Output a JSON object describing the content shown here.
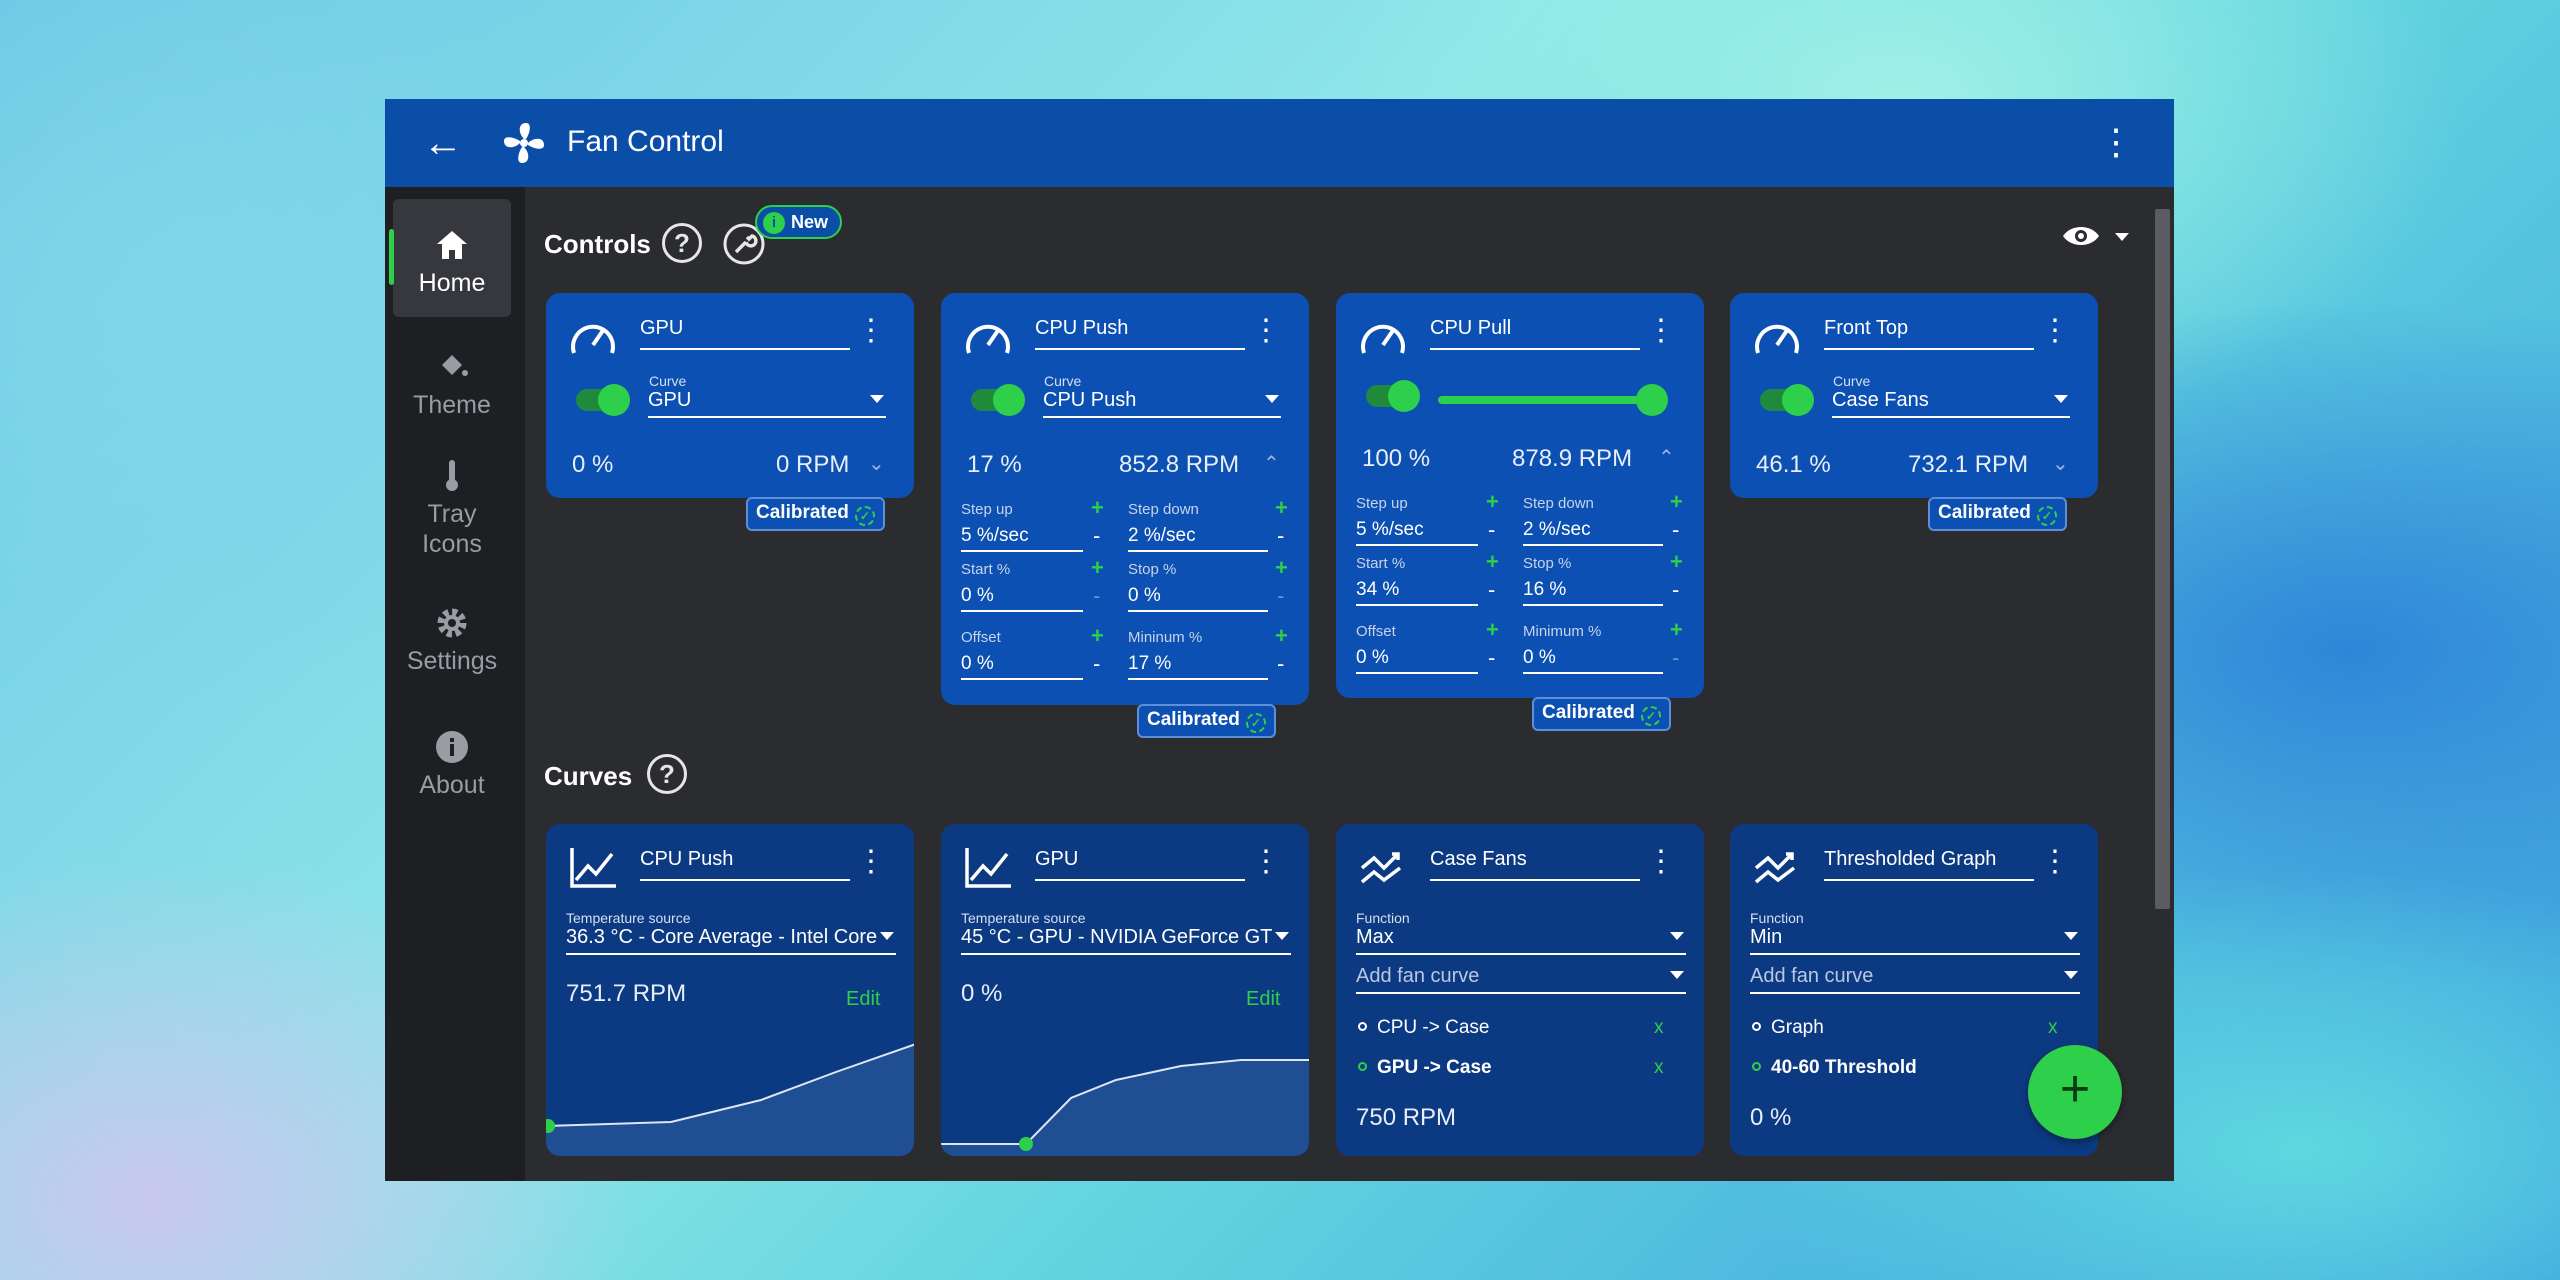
{
  "app": {
    "title": "Fan Control"
  },
  "nav": [
    {
      "label": "Home"
    },
    {
      "label": "Theme"
    },
    {
      "label": "Tray Icons"
    },
    {
      "label": "Settings"
    },
    {
      "label": "About"
    }
  ],
  "controls": {
    "heading": "Controls",
    "new_badge": "New",
    "cards": [
      {
        "name": "GPU",
        "curve_label": "Curve",
        "curve": "GPU",
        "percent": "0 %",
        "rpm": "0 RPM",
        "calibrated": "Calibrated"
      },
      {
        "name": "CPU Push",
        "curve_label": "Curve",
        "curve": "CPU Push",
        "percent": "17 %",
        "rpm": "852.8 RPM",
        "calibrated": "Calibrated",
        "step_up_label": "Step up",
        "step_up": "5 %/sec",
        "step_down_label": "Step down",
        "step_down": "2 %/sec",
        "start_label": "Start %",
        "start": "0 %",
        "stop_label": "Stop %",
        "stop": "0 %",
        "offset_label": "Offset",
        "offset": "0 %",
        "min_label": "Mininum %",
        "min": "17 %"
      },
      {
        "name": "CPU Pull",
        "percent": "100 %",
        "rpm": "878.9 RPM",
        "calibrated": "Calibrated",
        "slider_value": 1.0,
        "step_up_label": "Step up",
        "step_up": "5 %/sec",
        "step_down_label": "Step down",
        "step_down": "2 %/sec",
        "start_label": "Start %",
        "start": "34 %",
        "stop_label": "Stop %",
        "stop": "16 %",
        "offset_label": "Offset",
        "offset": "0 %",
        "min_label": "Minimum %",
        "min": "0 %"
      },
      {
        "name": "Front Top",
        "curve_label": "Curve",
        "curve": "Case Fans",
        "percent": "46.1 %",
        "rpm": "732.1 RPM",
        "calibrated": "Calibrated"
      }
    ]
  },
  "curves": {
    "heading": "Curves",
    "cards": [
      {
        "name": "CPU Push",
        "source_label": "Temperature source",
        "source": "36.3 °C - Core Average - Intel Core",
        "value": "751.7 RPM",
        "edit": "Edit"
      },
      {
        "name": "GPU",
        "source_label": "Temperature source",
        "source": "45 °C - GPU - NVIDIA GeForce GT",
        "value": "0 %",
        "edit": "Edit"
      },
      {
        "name": "Case Fans",
        "function_label": "Function",
        "function": "Max",
        "add_placeholder": "Add fan curve",
        "items": [
          "CPU -> Case",
          "GPU -> Case"
        ],
        "remove": "x",
        "value": "750 RPM"
      },
      {
        "name": "Thresholded Graph",
        "function_label": "Function",
        "function": "Min",
        "add_placeholder": "Add fan curve",
        "items": [
          "Graph",
          "40-60 Threshold"
        ],
        "remove": "x",
        "value": "0 %"
      }
    ]
  },
  "fab": "+",
  "colors": {
    "titlebar": "#0b4ea8",
    "card": "#0b50b2",
    "accent": "#2ecf4a",
    "window": "#2b2c30"
  }
}
